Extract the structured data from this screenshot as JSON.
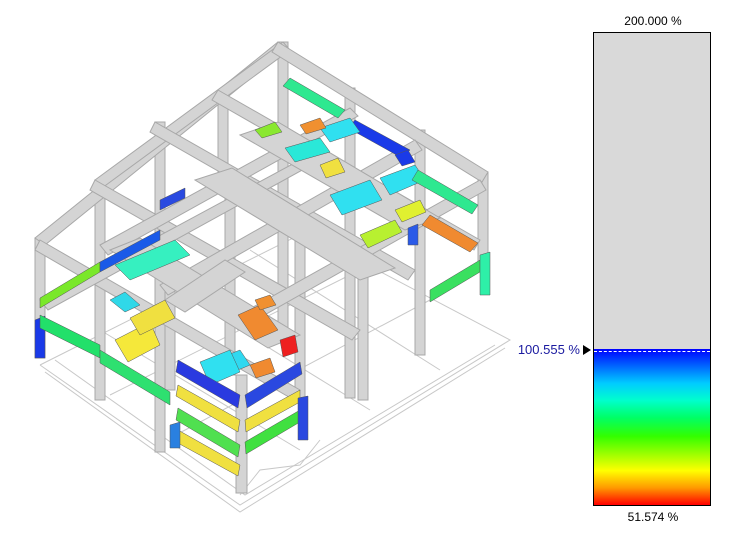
{
  "view": {
    "title": "",
    "colors": {
      "frame": "#d4d4d4",
      "frame_stroke": "#a8a8a8",
      "background": "#ffffff",
      "ghost_lines": "#c8c8c8"
    }
  },
  "legend": {
    "max_label": "200.000 %",
    "min_label": "51.574 %",
    "marker_label": "100.555 %",
    "max_value": 200.0,
    "min_value": 51.574,
    "marker_value": 100.555,
    "empty_color": "#d9d9d9",
    "gradient_colors": [
      "#0000ff",
      "#0066ff",
      "#00ccff",
      "#00ffcc",
      "#00ff66",
      "#33ff00",
      "#99ff00",
      "#ffff00",
      "#ff9900",
      "#ff0000"
    ]
  }
}
